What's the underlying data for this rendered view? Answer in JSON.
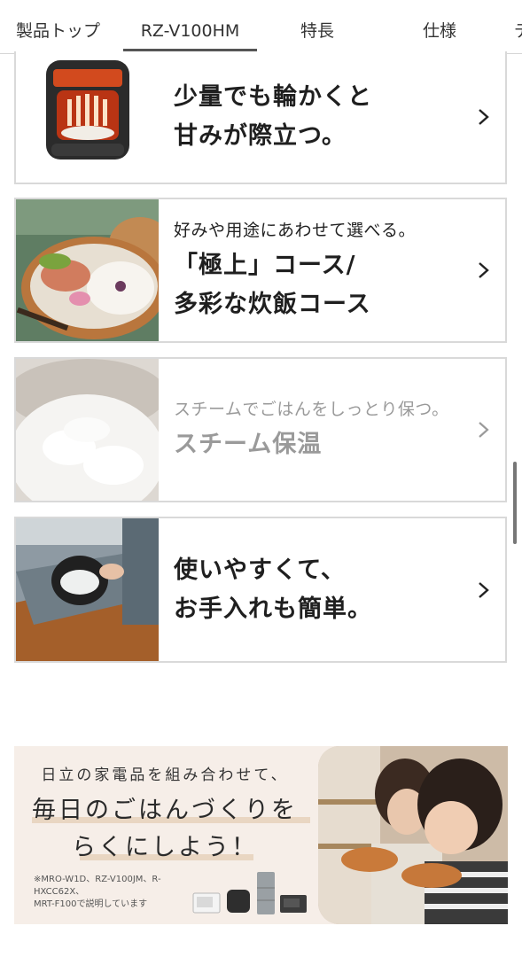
{
  "tabs": [
    {
      "label": "製品トップ",
      "active": false
    },
    {
      "label": "RZ-V100HM",
      "active": true
    },
    {
      "label": "特長",
      "active": false
    },
    {
      "label": "仕様",
      "active": false
    },
    {
      "label": "デ",
      "active": false
    }
  ],
  "cards": [
    {
      "lead": "",
      "title_lines": [
        "少量でも輪かくと",
        "甘みが際立つ。"
      ],
      "thumb_icon": "rice-cooker-product-image"
    },
    {
      "lead": "好みや用途にあわせて選べる。",
      "title_lines": [
        "「極上」コース/",
        "多彩な炊飯コース"
      ],
      "thumb_icon": "bento-box-photo"
    },
    {
      "lead": "スチームでごはんをしっとり保つ。",
      "title_lines": [
        "スチーム保温"
      ],
      "thumb_icon": "steamed-rice-bowl-photo"
    },
    {
      "lead": "",
      "title_lines": [
        "使いやすくて、",
        "お手入れも簡単。"
      ],
      "thumb_icon": "washing-rice-pot-photo"
    }
  ],
  "banner": {
    "line1": "日立の家電品を組み合わせて、",
    "line2": "毎日のごはんづくりを",
    "line3": "らくにしよう！",
    "note_line1": "※MRO-W1D、RZ-V100JM、R-HXCC62X、",
    "note_line2": "MRT-F100で説明しています"
  },
  "colors": {
    "accent_underline": "#555555",
    "card_border": "#d9d9d9",
    "banner_bg": "#f6eee8"
  }
}
